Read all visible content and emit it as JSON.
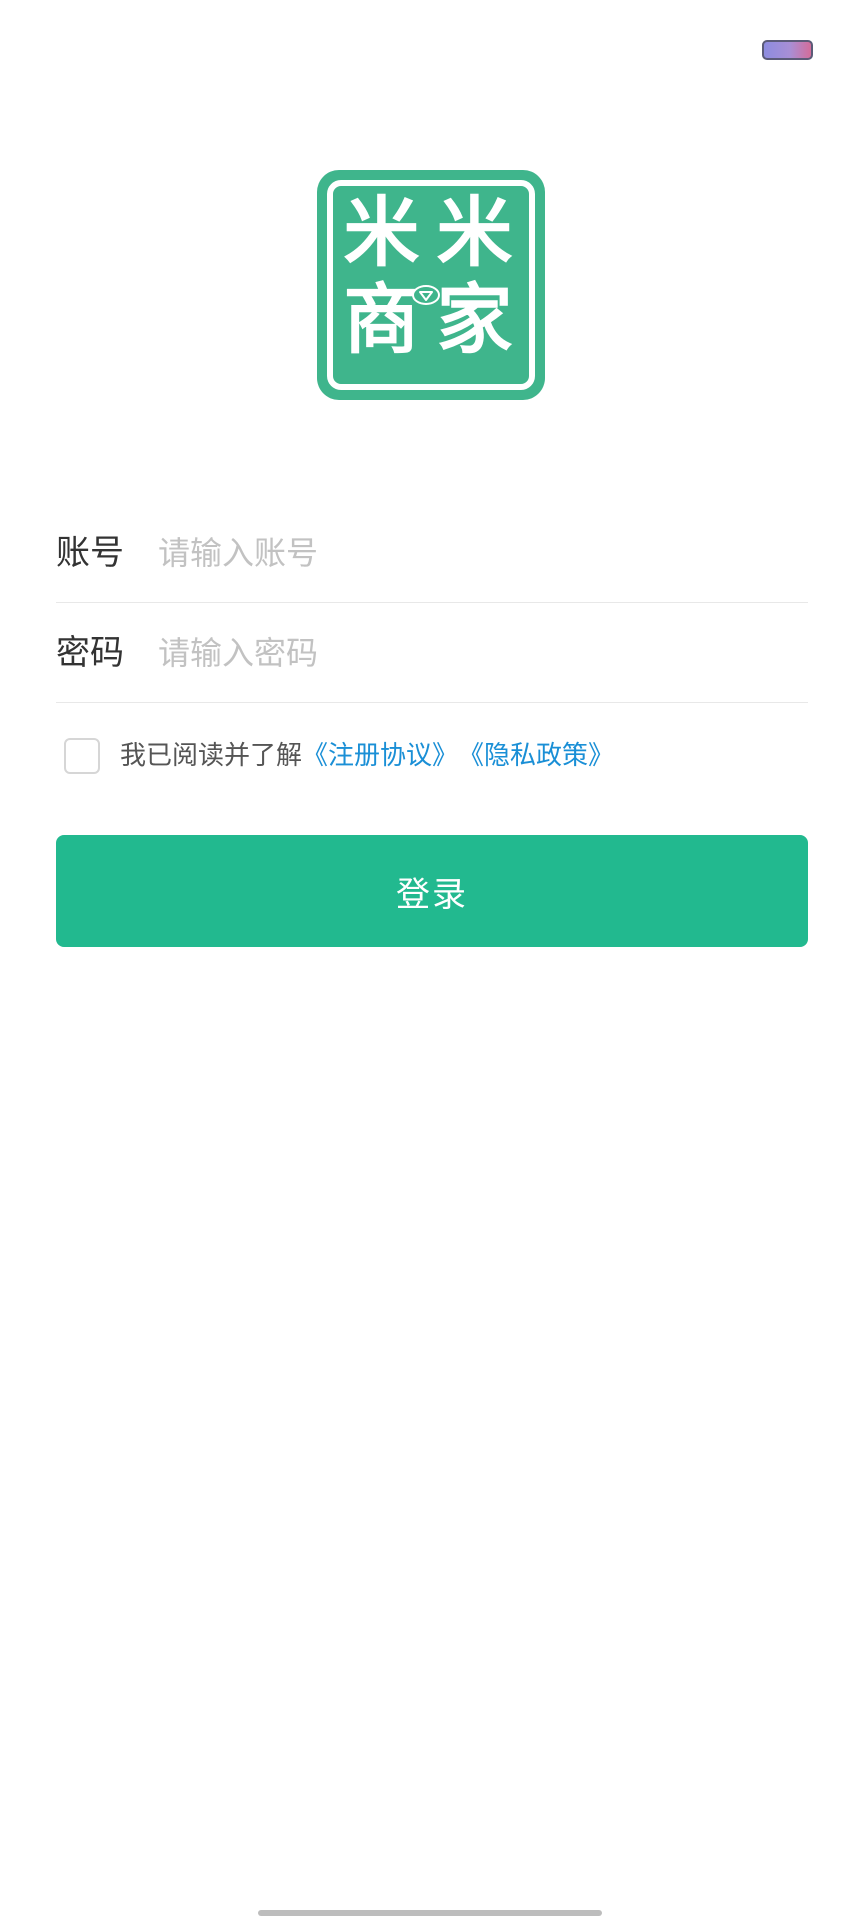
{
  "status_bar": {
    "battery_icon": "battery-icon"
  },
  "logo": {
    "chars": [
      "米",
      "米",
      "商",
      "家"
    ],
    "icon": "diamond-icon",
    "color": "#3fb58c"
  },
  "form": {
    "account": {
      "label": "账号",
      "placeholder": "请输入账号",
      "value": ""
    },
    "password": {
      "label": "密码",
      "placeholder": "请输入密码",
      "value": ""
    }
  },
  "agreement": {
    "checked": false,
    "text": "我已阅读并了解",
    "register_link": "《注册协议》",
    "privacy_link": "《隐私政策》",
    "link_color": "#1a8fd6"
  },
  "login": {
    "label": "登录",
    "color": "#22b98f"
  }
}
